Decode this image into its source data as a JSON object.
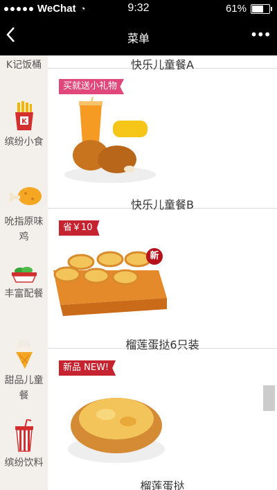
{
  "status_bar": {
    "carrier": "WeChat",
    "time": "9:32",
    "battery": "61%"
  },
  "nav": {
    "back_glyph": "<",
    "title": "菜单",
    "more_glyph": "•••"
  },
  "sidebar": {
    "items": [
      {
        "label": "K记饭桶",
        "icon": "none"
      },
      {
        "label": "缤纷小食",
        "icon": "fries-icon"
      },
      {
        "label": "吮指原味鸡",
        "icon": "chicken-leg-icon"
      },
      {
        "label": "丰富配餐",
        "icon": "salad-bowl-icon"
      },
      {
        "label": "甜品儿童餐",
        "icon": "ice-cream-icon"
      },
      {
        "label": "缤纷饮料",
        "icon": "drink-cup-icon"
      }
    ]
  },
  "menu": {
    "items": [
      {
        "name": "快乐儿童餐A"
      },
      {
        "name": "快乐儿童餐B",
        "tag": "买就送小礼物"
      },
      {
        "name": "榴莲蛋挞6只装",
        "tag": "省￥10",
        "badge": "新"
      },
      {
        "name": "榴莲蛋挞",
        "tag": "新品 NEW!"
      }
    ]
  },
  "colors": {
    "accent": "#c5232f",
    "sidebar_bg": "#f3efea"
  }
}
